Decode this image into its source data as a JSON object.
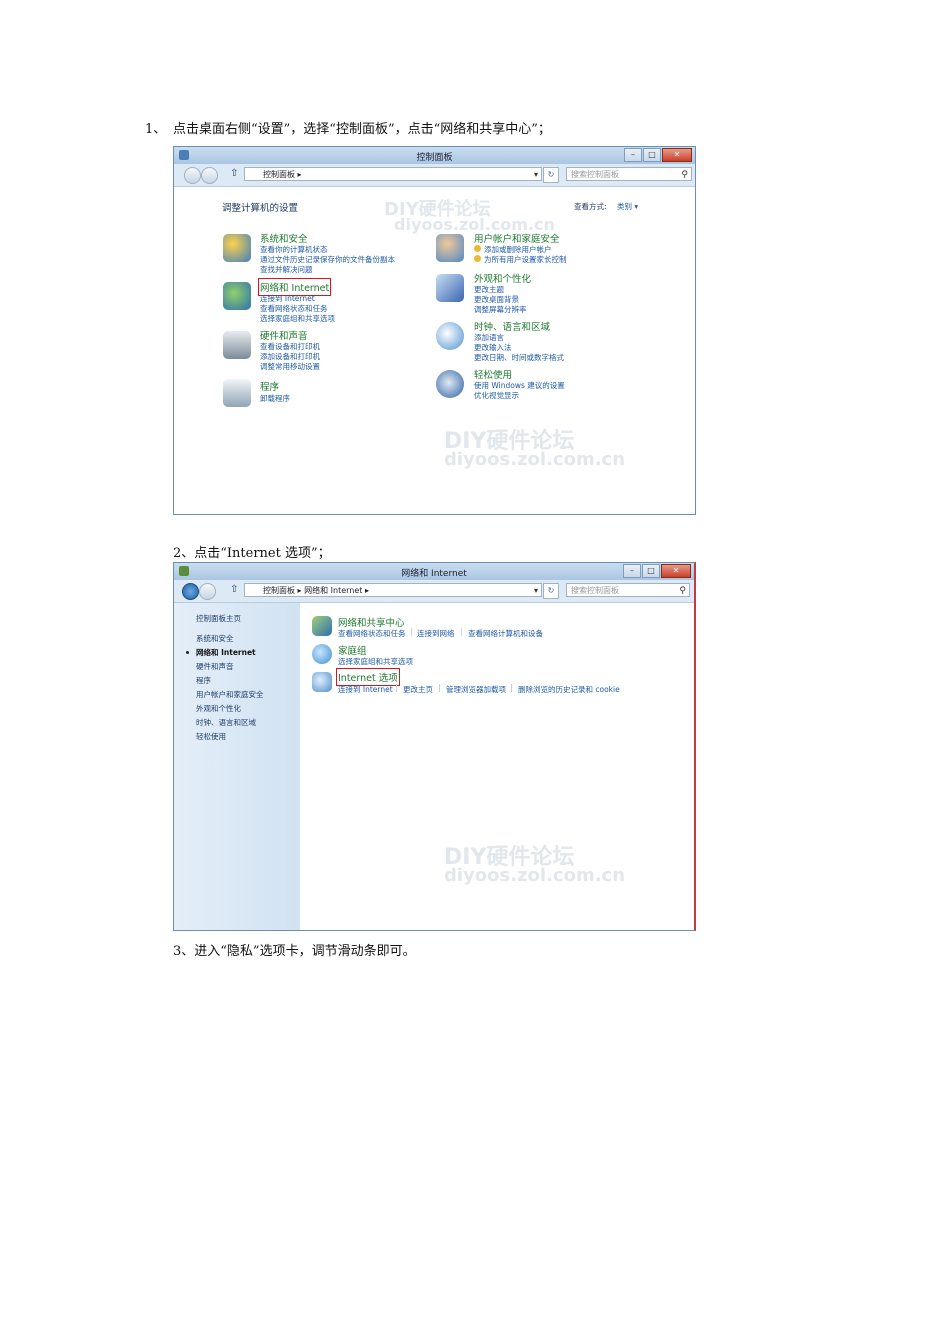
{
  "steps": {
    "s1_num": "1、",
    "s1_text": "点击桌面右侧“设置”，选择“控制面板”，点击“网络和共享中心”；",
    "s2_text": "2、点击“Internet  选项”；",
    "s3_text": "3、进入“隐私”选项卡，调节滑动条即可。"
  },
  "shot1": {
    "window_title": "控制面板",
    "address": "控制面板",
    "search_placeholder": "搜索控制面板",
    "heading": "调整计算机的设置",
    "view_by_label": "查看方式:",
    "view_by_value": "类别 ▾",
    "categories_left": [
      {
        "title": "系统和安全",
        "links": [
          "查看你的计算机状态",
          "通过文件历史记录保存你的文件备份副本",
          "查找并解决问题"
        ],
        "icon_color": "#3f7fbf"
      },
      {
        "title": "网络和 Internet",
        "links": [
          "连接到 Internet",
          "查看网络状态和任务",
          "选择家庭组和共享选项"
        ],
        "icon_color": "#2f6fb0"
      },
      {
        "title": "硬件和声音",
        "links": [
          "查看设备和打印机",
          "添加设备和打印机",
          "调整常用移动设置"
        ],
        "icon_color": "#7a8a99"
      },
      {
        "title": "程序",
        "links": [
          "卸载程序"
        ],
        "icon_color": "#8fa4b5"
      }
    ],
    "categories_right": [
      {
        "title": "用户帐户和家庭安全",
        "links": [
          "添加或删除用户帐户",
          "为所有用户设置家长控制"
        ],
        "icon_color": "#4d88c4"
      },
      {
        "title": "外观和个性化",
        "links": [
          "更改主题",
          "更改桌面背景",
          "调整屏幕分辨率"
        ],
        "icon_color": "#3a66b0"
      },
      {
        "title": "时钟、语言和区域",
        "links": [
          "添加语言",
          "更改输入法",
          "更改日期、时间或数字格式"
        ],
        "icon_color": "#4a8fcf"
      },
      {
        "title": "轻松使用",
        "links": [
          "使用 Windows 建议的设置",
          "优化视觉显示"
        ],
        "icon_color": "#2c5fa3"
      }
    ],
    "watermark_1": "DIY硬件论坛",
    "watermark_2": "diyoos.zol.com.cn"
  },
  "shot2": {
    "window_title": "网络和 Internet",
    "address": "控制面板 ▸ 网络和 Internet",
    "search_placeholder": "搜索控制面板",
    "sidebar": [
      "控制面板主页",
      "系统和安全",
      "网络和 Internet",
      "硬件和声音",
      "程序",
      "用户帐户和家庭安全",
      "外观和个性化",
      "时钟、语言和区域",
      "轻松使用"
    ],
    "sections": [
      {
        "title": "网络和共享中心",
        "links": [
          "查看网络状态和任务",
          "连接到网络",
          "查看网络计算机和设备"
        ],
        "icon_color": "#2f6fb0"
      },
      {
        "title": "家庭组",
        "links": [
          "选择家庭组和共享选项"
        ],
        "icon_color": "#3f8fd0"
      },
      {
        "title": "Internet 选项",
        "links": [
          "连接到 Internet",
          "更改主页",
          "管理浏览器加载项",
          "删除浏览的历史记录和 cookie"
        ],
        "icon_color": "#4f8fc8"
      }
    ],
    "watermark_1": "DIY硬件论坛",
    "watermark_2": "diyoos.zol.com.cn"
  }
}
